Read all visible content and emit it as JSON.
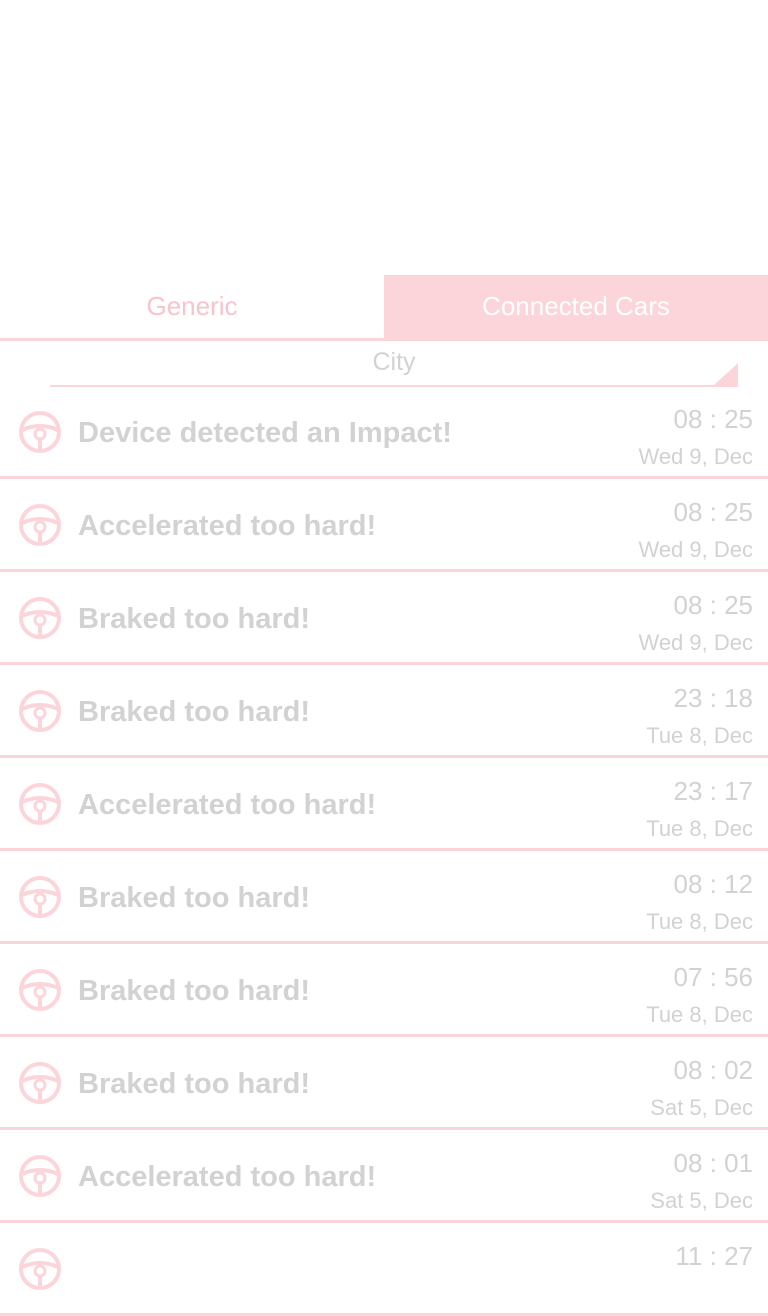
{
  "tabs": [
    {
      "label": "Generic",
      "active": false
    },
    {
      "label": "Connected Cars",
      "active": true
    }
  ],
  "filter": {
    "selected": "City"
  },
  "colors": {
    "accent": "#fbd5da",
    "text_muted": "#d2d2d2",
    "tab_inactive_text": "#f8c4cb"
  },
  "events": [
    {
      "icon": "steering-wheel-icon",
      "title": "Device detected an Impact!",
      "time": "08 : 25",
      "date": "Wed 9, Dec"
    },
    {
      "icon": "steering-wheel-icon",
      "title": "Accelerated too hard!",
      "time": "08 : 25",
      "date": "Wed 9, Dec"
    },
    {
      "icon": "steering-wheel-icon",
      "title": "Braked too hard!",
      "time": "08 : 25",
      "date": "Wed 9, Dec"
    },
    {
      "icon": "steering-wheel-icon",
      "title": "Braked too hard!",
      "time": "23 : 18",
      "date": "Tue 8, Dec"
    },
    {
      "icon": "steering-wheel-icon",
      "title": "Accelerated too hard!",
      "time": "23 : 17",
      "date": "Tue 8, Dec"
    },
    {
      "icon": "steering-wheel-icon",
      "title": "Braked too hard!",
      "time": "08 : 12",
      "date": "Tue 8, Dec"
    },
    {
      "icon": "steering-wheel-icon",
      "title": "Braked too hard!",
      "time": "07 : 56",
      "date": "Tue 8, Dec"
    },
    {
      "icon": "steering-wheel-icon",
      "title": "Braked too hard!",
      "time": "08 : 02",
      "date": "Sat 5, Dec"
    },
    {
      "icon": "steering-wheel-icon",
      "title": "Accelerated too hard!",
      "time": "08 : 01",
      "date": "Sat 5, Dec"
    },
    {
      "icon": "steering-wheel-icon",
      "title": "",
      "time": "11 : 27",
      "date": ""
    }
  ]
}
